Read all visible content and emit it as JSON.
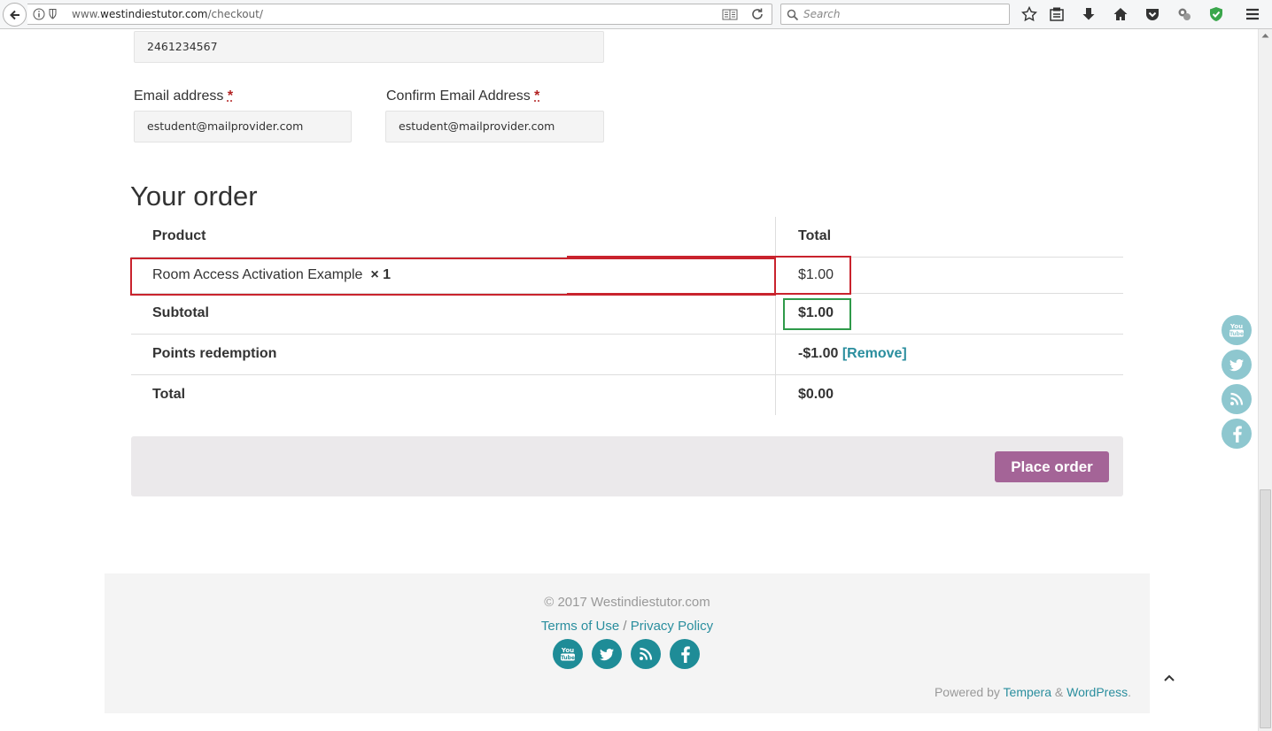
{
  "browser": {
    "url_prefix": "www.",
    "url_domain": "westindiestutor.com",
    "url_path": "/checkout/",
    "search_placeholder": "Search"
  },
  "form": {
    "phone_value": "2461234567",
    "email_label": "Email address",
    "email_value": "estudent@mailprovider.com",
    "confirm_email_label": "Confirm Email Address",
    "confirm_email_value": "estudent@mailprovider.com",
    "required_mark": "*"
  },
  "order": {
    "heading": "Your order",
    "col_product": "Product",
    "col_total": "Total",
    "item_name": "Room Access Activation Example",
    "item_qty": "× 1",
    "item_total": "$1.00",
    "subtotal_label": "Subtotal",
    "subtotal_value": "$1.00",
    "points_label": "Points redemption",
    "points_value": "-$1.00",
    "points_remove": "[Remove]",
    "total_label": "Total",
    "total_value": "$0.00",
    "place_order": "Place order"
  },
  "footer": {
    "copyright": "© 2017 Westindiestutor.com",
    "terms": "Terms of Use",
    "separator": "/",
    "privacy": "Privacy Policy",
    "powered_prefix": "Powered by",
    "tempera": "Tempera",
    "amp": "&",
    "wordpress": "WordPress",
    "period": "."
  },
  "social": [
    "youtube-icon",
    "twitter-icon",
    "rss-icon",
    "facebook-icon"
  ],
  "colors": {
    "accent": "#2a8e9e",
    "button": "#a46497",
    "highlight_red": "#c9232d",
    "highlight_green": "#2f9a4a"
  }
}
